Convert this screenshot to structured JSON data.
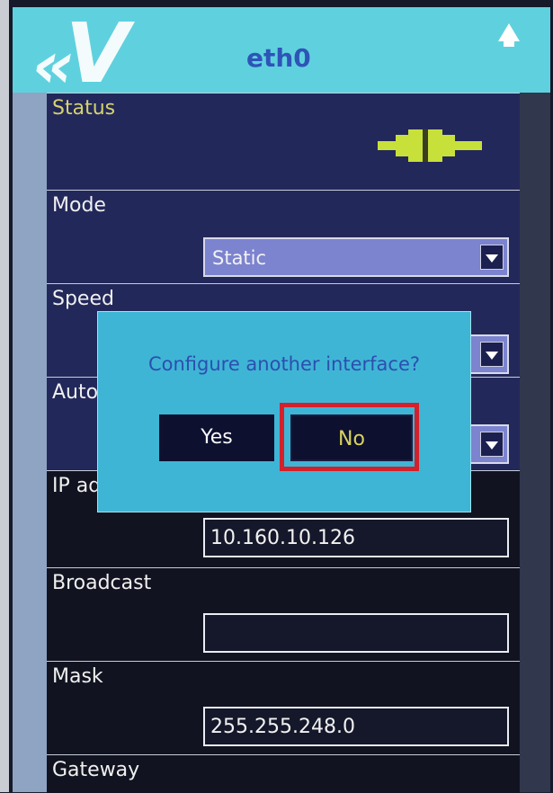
{
  "header": {
    "title": "eth0",
    "logo_text": "KV",
    "up_icon": "up-arrow-icon"
  },
  "fields": {
    "status": {
      "label": "Status",
      "icon": "plug-connected-icon",
      "icon_color": "#c8e03a"
    },
    "mode": {
      "label": "Mode",
      "value": "Static"
    },
    "speed": {
      "label": "Speed"
    },
    "auto": {
      "label": "Auto"
    },
    "ip": {
      "label": "IP ad",
      "value": "10.160.10.126"
    },
    "broadcast": {
      "label": "Broadcast",
      "value": ""
    },
    "mask": {
      "label": "Mask",
      "value": "255.255.248.0"
    },
    "gateway": {
      "label": "Gateway"
    }
  },
  "dialog": {
    "message": "Configure another interface?",
    "yes_label": "Yes",
    "no_label": "No",
    "highlighted": "No",
    "highlight_color": "#d4202a"
  },
  "colors": {
    "header_bg": "#5fd1de",
    "dialog_bg": "#3fb5d6",
    "title": "#2e54b8"
  }
}
